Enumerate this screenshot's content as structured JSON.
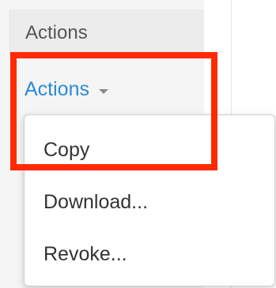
{
  "header": {
    "label": "Actions"
  },
  "actions": {
    "toggle_label": "Actions",
    "toggle_icon": "caret-down-icon",
    "menu": {
      "items": [
        {
          "label": "Copy"
        },
        {
          "label": "Download..."
        },
        {
          "label": "Revoke..."
        }
      ]
    }
  },
  "colors": {
    "link": "#2a8ad9",
    "highlight": "#ff2a00"
  }
}
